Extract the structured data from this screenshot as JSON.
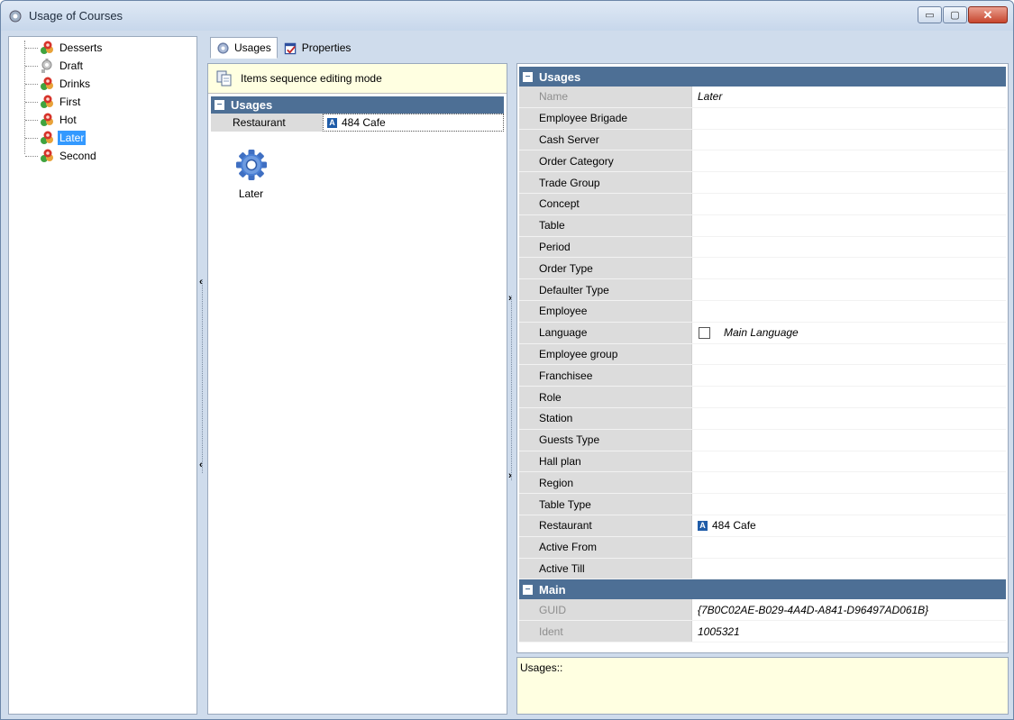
{
  "window": {
    "title": "Usage of Courses",
    "minimize": "▭",
    "maximize": "▢",
    "close": "✕"
  },
  "tree": {
    "items": [
      {
        "label": "Desserts",
        "icon": "course-icon"
      },
      {
        "label": "Draft",
        "icon": "course-gray-icon"
      },
      {
        "label": "Drinks",
        "icon": "course-icon"
      },
      {
        "label": "First",
        "icon": "course-icon"
      },
      {
        "label": "Hot",
        "icon": "course-icon"
      },
      {
        "label": "Later",
        "icon": "course-icon",
        "selected": true
      },
      {
        "label": "Second",
        "icon": "course-icon"
      }
    ]
  },
  "tabs": [
    {
      "label": "Usages",
      "icon": "gear-icon",
      "active": true
    },
    {
      "label": "Properties",
      "icon": "properties-icon",
      "active": false
    }
  ],
  "center": {
    "sequence_mode_label": "Items sequence editing mode",
    "category": "Usages",
    "row_key": "Restaurant",
    "row_badge": "A",
    "row_value": "484 Cafe",
    "item_label": "Later"
  },
  "splitters": {
    "left_arrow": "‹",
    "mid_arrow": "›"
  },
  "properties": {
    "usages_category": "Usages",
    "main_category": "Main",
    "toggle_symbol": "−",
    "rows": [
      {
        "key": "Name",
        "value": "Later",
        "readonly": true,
        "italic": true
      },
      {
        "key": "Employee Brigade",
        "value": ""
      },
      {
        "key": "Cash Server",
        "value": ""
      },
      {
        "key": "Order Category",
        "value": ""
      },
      {
        "key": "Trade Group",
        "value": ""
      },
      {
        "key": "Concept",
        "value": ""
      },
      {
        "key": "Table",
        "value": ""
      },
      {
        "key": "Period",
        "value": ""
      },
      {
        "key": "Order Type",
        "value": ""
      },
      {
        "key": "Defaulter Type",
        "value": ""
      },
      {
        "key": "Employee",
        "value": ""
      },
      {
        "key": "Language",
        "value": "Main Language",
        "checkbox": true,
        "italic": true
      },
      {
        "key": "Employee group",
        "value": ""
      },
      {
        "key": "Franchisee",
        "value": ""
      },
      {
        "key": "Role",
        "value": ""
      },
      {
        "key": "Station",
        "value": ""
      },
      {
        "key": "Guests Type",
        "value": ""
      },
      {
        "key": "Hall plan",
        "value": ""
      },
      {
        "key": "Region",
        "value": ""
      },
      {
        "key": "Table Type",
        "value": ""
      },
      {
        "key": "Restaurant",
        "value": "484 Cafe",
        "badge": "A"
      },
      {
        "key": "Active From",
        "value": ""
      },
      {
        "key": "Active Till",
        "value": ""
      }
    ],
    "main_rows": [
      {
        "key": "GUID",
        "value": "{7B0C02AE-B029-4A4D-A841-D96497AD061B}",
        "readonly": true,
        "italic": true
      },
      {
        "key": "Ident",
        "value": "1005321",
        "readonly": true,
        "italic": true
      }
    ]
  },
  "description": {
    "text": "Usages::"
  },
  "colors": {
    "category_header": "#4d6f95",
    "selection": "#3399ff",
    "info_background": "#ffffe1"
  }
}
